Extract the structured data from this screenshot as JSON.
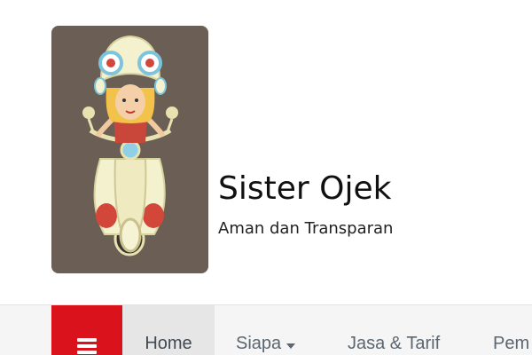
{
  "site": {
    "title": "Sister Ojek",
    "tagline": "Aman dan Transparan"
  },
  "nav": {
    "menu_icon": "hamburger-menu-icon",
    "items": [
      {
        "label": "Home",
        "active": true
      },
      {
        "label": "Siapa",
        "dropdown": true
      },
      {
        "label": "Jasa & Tarif"
      },
      {
        "label": "Pem"
      }
    ]
  },
  "colors": {
    "accent": "#d9121b",
    "logo_background": "#6b5f55",
    "nav_background": "#f5f5f5",
    "nav_active": "#e6e6e6"
  }
}
